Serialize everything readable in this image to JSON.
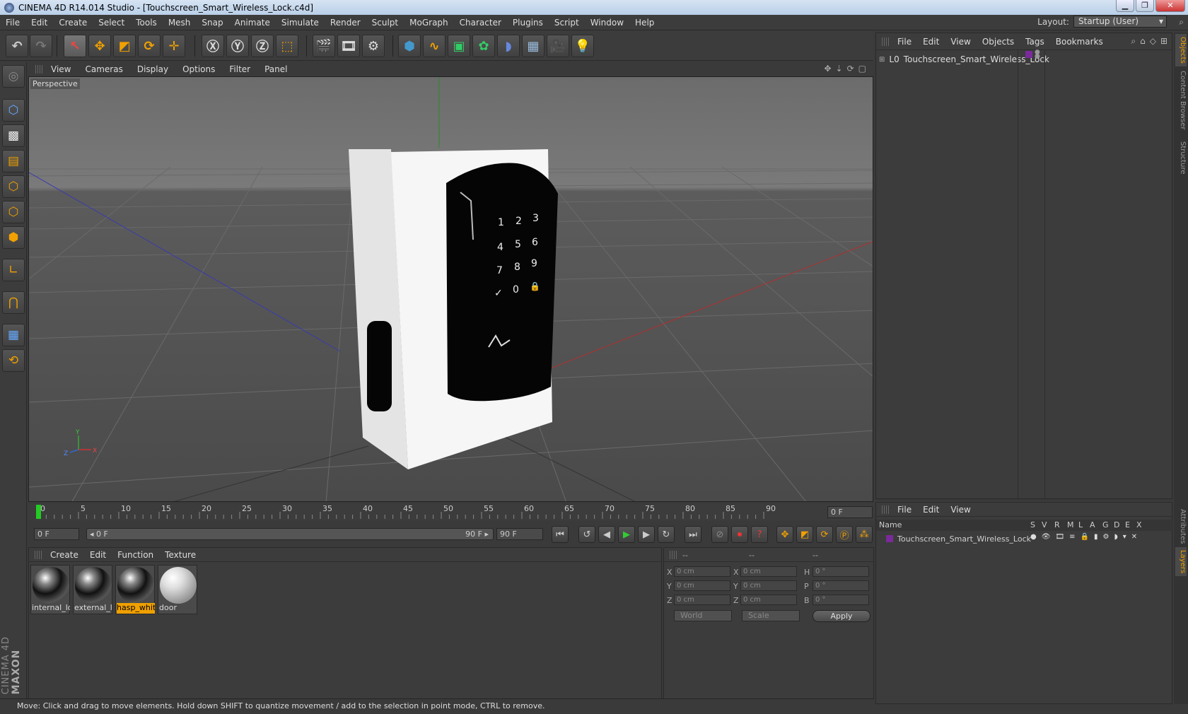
{
  "window": {
    "title": "CINEMA 4D R14.014 Studio - [Touchscreen_Smart_Wireless_Lock.c4d]",
    "minimize": "▁",
    "restore": "❐",
    "close": "✕"
  },
  "menu": [
    "File",
    "Edit",
    "Create",
    "Select",
    "Tools",
    "Mesh",
    "Snap",
    "Animate",
    "Simulate",
    "Render",
    "Sculpt",
    "MoGraph",
    "Character",
    "Plugins",
    "Script",
    "Window",
    "Help"
  ],
  "layout": {
    "label": "Layout:",
    "value": "Startup (User)"
  },
  "viewport": {
    "menu": [
      "View",
      "Cameras",
      "Display",
      "Options",
      "Filter",
      "Panel"
    ],
    "label": "Perspective",
    "keypad": [
      "1",
      "2",
      "3",
      "4",
      "5",
      "6",
      "7",
      "8",
      "9",
      "✓",
      "0",
      "🔒"
    ],
    "axis_labels": {
      "y": "Y",
      "z": "Z",
      "x": "X"
    }
  },
  "timeline": {
    "ticks": [
      "0",
      "5",
      "10",
      "15",
      "20",
      "25",
      "30",
      "35",
      "40",
      "45",
      "50",
      "55",
      "60",
      "65",
      "70",
      "75",
      "80",
      "85",
      "90"
    ],
    "current_frame": "0 F",
    "start_field": "0 F",
    "range_start": "◂ 0 F",
    "range_end": "90 F ▸",
    "end_field": "90 F"
  },
  "materials": {
    "menu": [
      "Create",
      "Edit",
      "Function",
      "Texture"
    ],
    "items": [
      {
        "name": "internal_lo",
        "selected": false,
        "kind": "chrome"
      },
      {
        "name": "external_lo",
        "selected": false,
        "kind": "chrome"
      },
      {
        "name": "hasp_white",
        "selected": true,
        "kind": "chrome"
      },
      {
        "name": "door",
        "selected": false,
        "kind": "white"
      }
    ]
  },
  "coords": {
    "headers": [
      "--",
      "--",
      "--"
    ],
    "rows": [
      {
        "a": "X",
        "av": "0 cm",
        "b": "X",
        "bv": "0 cm",
        "c": "H",
        "cv": "0 °"
      },
      {
        "a": "Y",
        "av": "0 cm",
        "b": "Y",
        "bv": "0 cm",
        "c": "P",
        "cv": "0 °"
      },
      {
        "a": "Z",
        "av": "0 cm",
        "b": "Z",
        "bv": "0 cm",
        "c": "B",
        "cv": "0 °"
      }
    ],
    "space": "World",
    "mode": "Scale",
    "apply": "Apply"
  },
  "objects": {
    "menu": [
      "File",
      "Edit",
      "View",
      "Objects",
      "Tags",
      "Bookmarks"
    ],
    "item": "Touchscreen_Smart_Wireless_Lock",
    "layer_color": "#7a2a9a"
  },
  "layers": {
    "menu": [
      "File",
      "Edit",
      "View"
    ],
    "columns": [
      "Name",
      "S",
      "V",
      "R",
      "M",
      "L",
      "A",
      "G",
      "D",
      "E",
      "X"
    ],
    "item": "Touchscreen_Smart_Wireless_Lock"
  },
  "side_tabs": [
    "Objects",
    "Content Browser",
    "Structure"
  ],
  "side_tabs_bottom": [
    "Attributes",
    "Layers"
  ],
  "brand": {
    "line1": "MAXON",
    "line2": "CINEMA 4D"
  },
  "status": "Move: Click and drag to move elements. Hold down SHIFT to quantize movement / add to the selection in point mode, CTRL to remove."
}
